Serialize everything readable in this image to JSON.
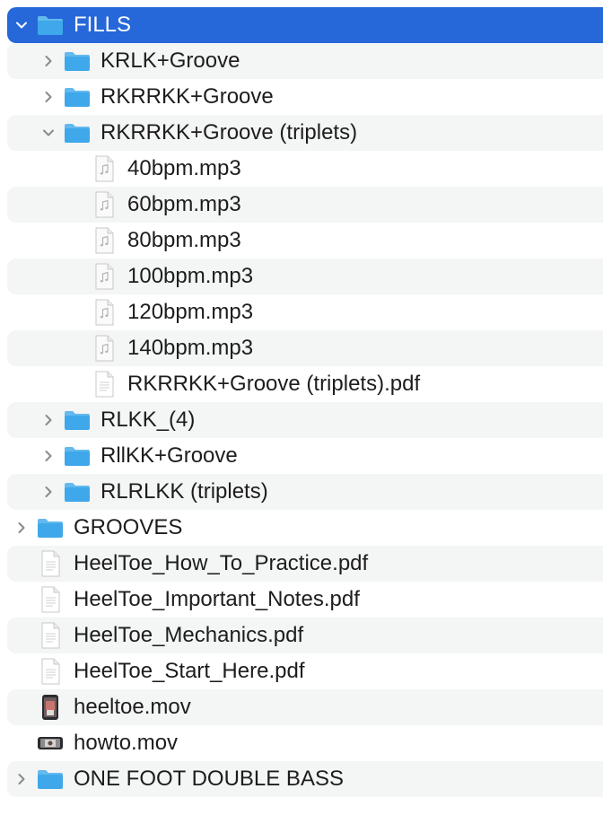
{
  "colors": {
    "selection": "#2667d9",
    "folder": "#3ea8ea",
    "row_alt": "#f4f5f5",
    "text": "#1d1d1f"
  },
  "rows": [
    {
      "id": "fills",
      "label": "FILLS",
      "type": "folder",
      "level": 0,
      "expanded": true,
      "selected": true
    },
    {
      "id": "krlk",
      "label": "KRLK+Groove",
      "type": "folder",
      "level": 1,
      "expanded": false
    },
    {
      "id": "rkrrkk",
      "label": "RKRRKK+Groove",
      "type": "folder",
      "level": 1,
      "expanded": false
    },
    {
      "id": "rkrrkk-triplets",
      "label": "RKRRKK+Groove (triplets)",
      "type": "folder",
      "level": 1,
      "expanded": true
    },
    {
      "id": "40bpm",
      "label": "40bpm.mp3",
      "type": "audio",
      "level": 2
    },
    {
      "id": "60bpm",
      "label": "60bpm.mp3",
      "type": "audio",
      "level": 2
    },
    {
      "id": "80bpm",
      "label": "80bpm.mp3",
      "type": "audio",
      "level": 2
    },
    {
      "id": "100bpm",
      "label": "100bpm.mp3",
      "type": "audio",
      "level": 2
    },
    {
      "id": "120bpm",
      "label": "120bpm.mp3",
      "type": "audio",
      "level": 2
    },
    {
      "id": "140bpm",
      "label": "140bpm.mp3",
      "type": "audio",
      "level": 2
    },
    {
      "id": "triplets-pdf",
      "label": "RKRRKK+Groove (triplets).pdf",
      "type": "document",
      "level": 2
    },
    {
      "id": "rlkk4",
      "label": "RLKK_(4)",
      "type": "folder",
      "level": 1,
      "expanded": false
    },
    {
      "id": "rllkk",
      "label": "RllKK+Groove",
      "type": "folder",
      "level": 1,
      "expanded": false
    },
    {
      "id": "rlrlkk",
      "label": "RLRLKK (triplets)",
      "type": "folder",
      "level": 1,
      "expanded": false
    },
    {
      "id": "grooves",
      "label": "GROOVES",
      "type": "folder",
      "level": 0,
      "expanded": false
    },
    {
      "id": "how-to-practice",
      "label": "HeelToe_How_To_Practice.pdf",
      "type": "document",
      "level": 0
    },
    {
      "id": "important-notes",
      "label": "HeelToe_Important_Notes.pdf",
      "type": "document",
      "level": 0
    },
    {
      "id": "mechanics",
      "label": "HeelToe_Mechanics.pdf",
      "type": "document",
      "level": 0
    },
    {
      "id": "start-here",
      "label": "HeelToe_Start_Here.pdf",
      "type": "document",
      "level": 0
    },
    {
      "id": "heeltoe-mov",
      "label": "heeltoe.mov",
      "type": "video-portrait",
      "level": 0
    },
    {
      "id": "howto-mov",
      "label": "howto.mov",
      "type": "video-landscape",
      "level": 0
    },
    {
      "id": "one-foot",
      "label": "ONE FOOT DOUBLE BASS",
      "type": "folder",
      "level": 0,
      "expanded": false
    }
  ]
}
